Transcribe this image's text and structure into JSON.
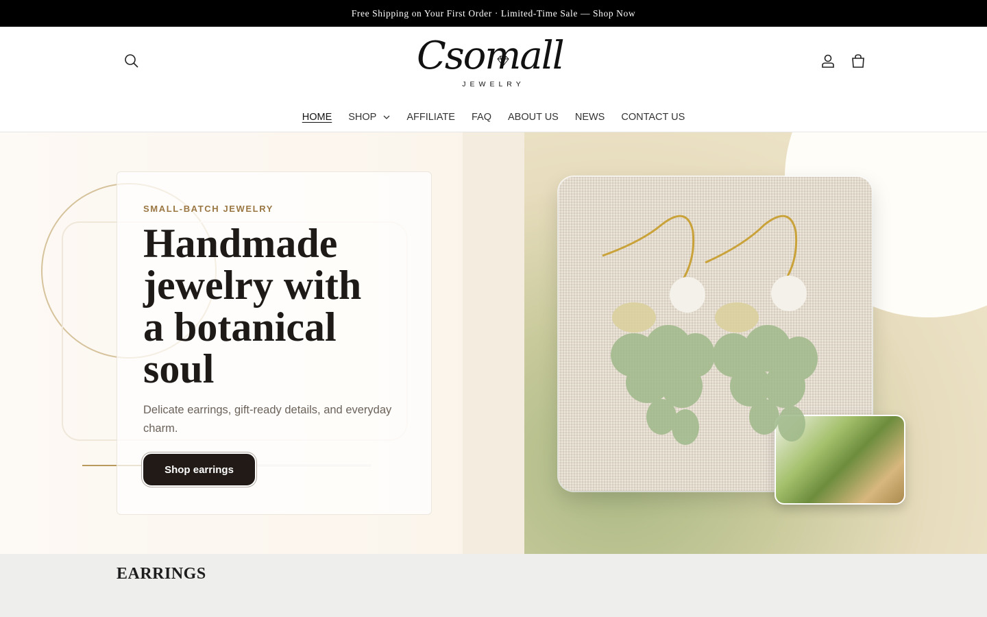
{
  "announcement": "Free Shipping on Your First Order · Limited-Time Sale — Shop Now",
  "logo": {
    "script": "Csomall",
    "sub": "JEWELRY"
  },
  "nav": [
    {
      "label": "HOME",
      "active": true
    },
    {
      "label": "SHOP",
      "dropdown": true
    },
    {
      "label": "AFFILIATE"
    },
    {
      "label": "FAQ"
    },
    {
      "label": "ABOUT US"
    },
    {
      "label": "NEWS"
    },
    {
      "label": "CONTACT US"
    }
  ],
  "header_icons": [
    "search-icon",
    "account-icon",
    "cart-icon"
  ],
  "hero": {
    "eyebrow": "SMALL-BATCH JEWELRY",
    "headline": "Handmade jewelry with a botanical soul",
    "subtext": "Delicate earrings, gift-ready details, and everyday charm.",
    "cta_label": "Shop earrings"
  },
  "section": {
    "title": "EARRINGS"
  },
  "colors": {
    "accent_gold": "#9a7743",
    "button_dark": "#221a16",
    "announce_bg": "#000000"
  }
}
